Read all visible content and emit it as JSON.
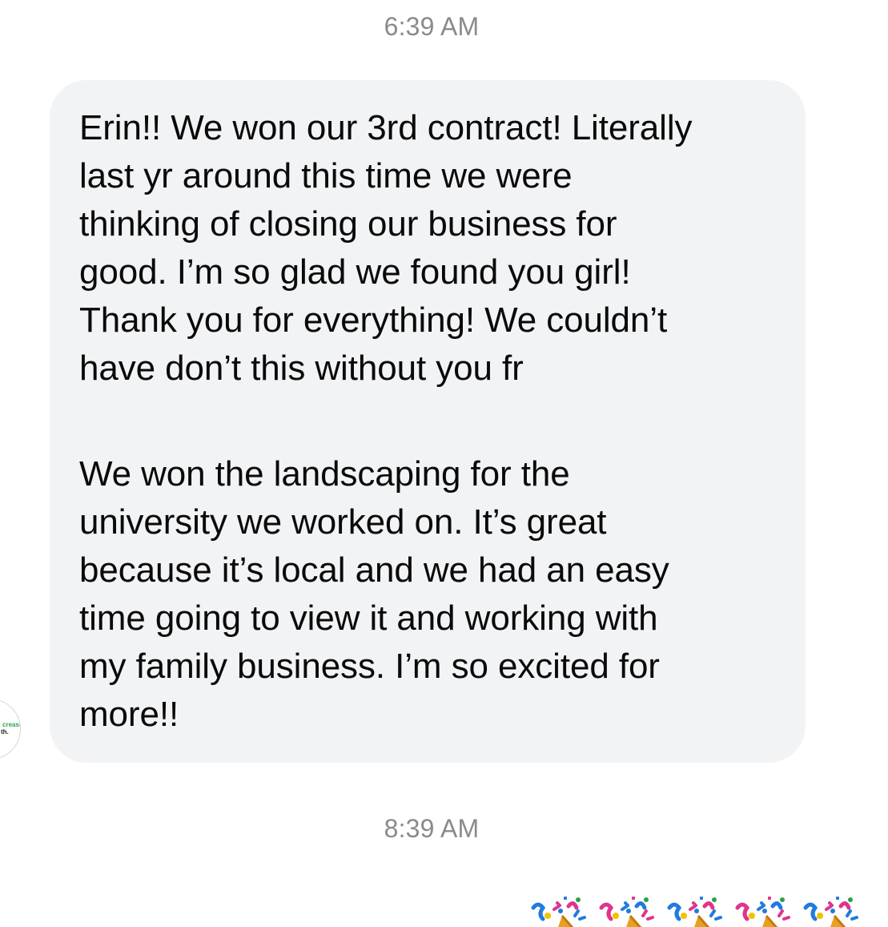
{
  "thread": {
    "timestamp_top": "6:39 AM",
    "timestamp_bottom": "8:39 AM"
  },
  "message": {
    "paragraph_1": "Erin!! We won our 3rd contract! Literally\nlast yr around this time we were\nthinking of closing our business for\ngood. I’m so glad we found you girl!\nThank you for everything! We couldn’t\nhave don’t this without you fr",
    "paragraph_2": "We won the landscaping for the\nuniversity we worked on. It’s great\nbecause it’s local and we had an easy\ntime going to view it and working with\nmy family business. I’m so excited for\nmore!!"
  },
  "avatar": {
    "line_1": "creased",
    "line_2": "th."
  },
  "reaction_row": {
    "emoji": [
      "party-popper-icon",
      "party-popper-icon",
      "party-popper-icon"
    ]
  },
  "colors": {
    "bubble_bg": "#f2f3f5",
    "text": "#0a0a0a",
    "timestamp": "#8a8a8e"
  }
}
